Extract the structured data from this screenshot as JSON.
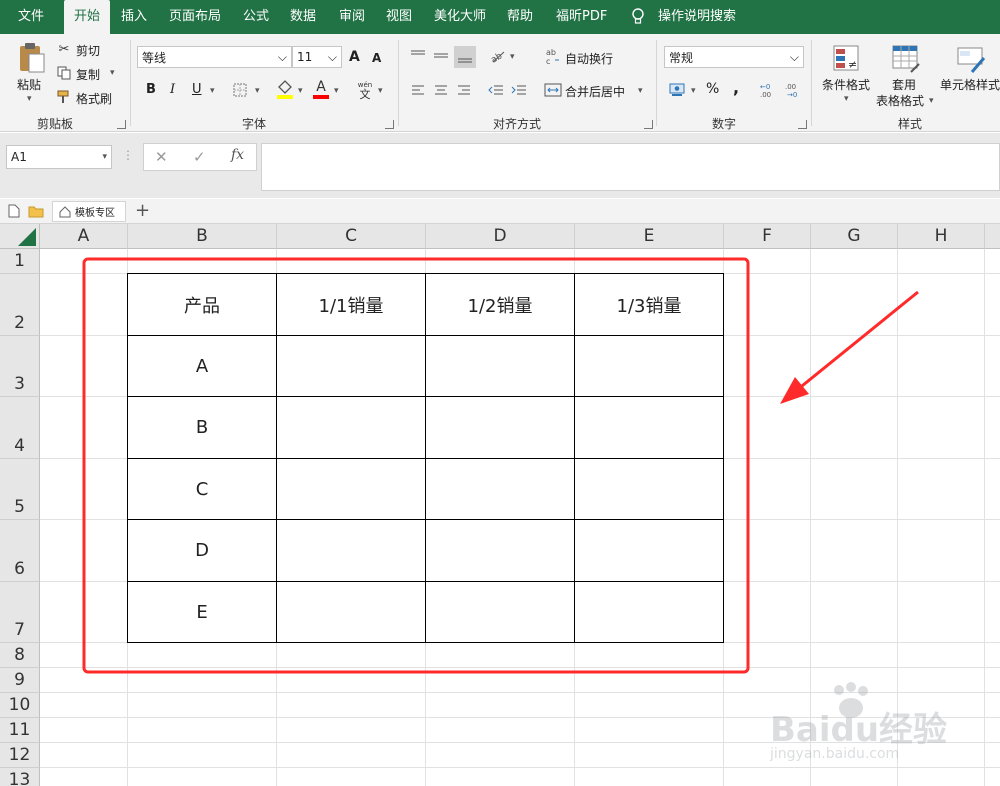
{
  "menu": {
    "tabs": [
      "文件",
      "开始",
      "插入",
      "页面布局",
      "公式",
      "数据",
      "审阅",
      "视图",
      "美化大师",
      "帮助",
      "福昕PDF"
    ],
    "active": "开始",
    "tell_me": "操作说明搜索"
  },
  "ribbon": {
    "clipboard": {
      "paste": "粘贴",
      "cut": "剪切",
      "copy": "复制",
      "format_painter": "格式刷",
      "label": "剪贴板"
    },
    "font": {
      "name": "等线",
      "size": "11",
      "bold": "B",
      "italic": "I",
      "underline": "U",
      "label": "字体",
      "grow": "A",
      "shrink": "A",
      "color_glyph": "A",
      "phonetic_top": "wén",
      "phonetic_bottom": "文"
    },
    "alignment": {
      "wrap": "自动换行",
      "merge": "合并后居中",
      "label": "对齐方式"
    },
    "number": {
      "format": "常规",
      "percent": "%",
      "comma": ",",
      "label": "数字"
    },
    "styles": {
      "conditional": "条件格式",
      "table_format_1": "套用",
      "table_format_2": "表格格式",
      "cell_styles": "单元格样式",
      "label": "样式"
    }
  },
  "formula_bar": {
    "name_box": "A1",
    "fx": "fx",
    "value": ""
  },
  "sheet_tabs": {
    "template_tab": "模板专区",
    "add": "+"
  },
  "columns": [
    "A",
    "B",
    "C",
    "D",
    "E",
    "F",
    "G",
    "H"
  ],
  "rows": [
    "1",
    "2",
    "3",
    "4",
    "5",
    "6",
    "7",
    "8",
    "9",
    "10",
    "11",
    "12",
    "13"
  ],
  "table": {
    "header": [
      "产品",
      "1/1销量",
      "1/2销量",
      "1/3销量"
    ],
    "rows": [
      [
        "A",
        "",
        "",
        ""
      ],
      [
        "B",
        "",
        "",
        ""
      ],
      [
        "C",
        "",
        "",
        ""
      ],
      [
        "D",
        "",
        "",
        ""
      ],
      [
        "E",
        "",
        "",
        ""
      ]
    ]
  },
  "watermark": {
    "brand": "Baidu经验",
    "url": "jingyan.baidu.com"
  },
  "colors": {
    "accent": "#217346",
    "annotation": "#ff2a2a"
  }
}
